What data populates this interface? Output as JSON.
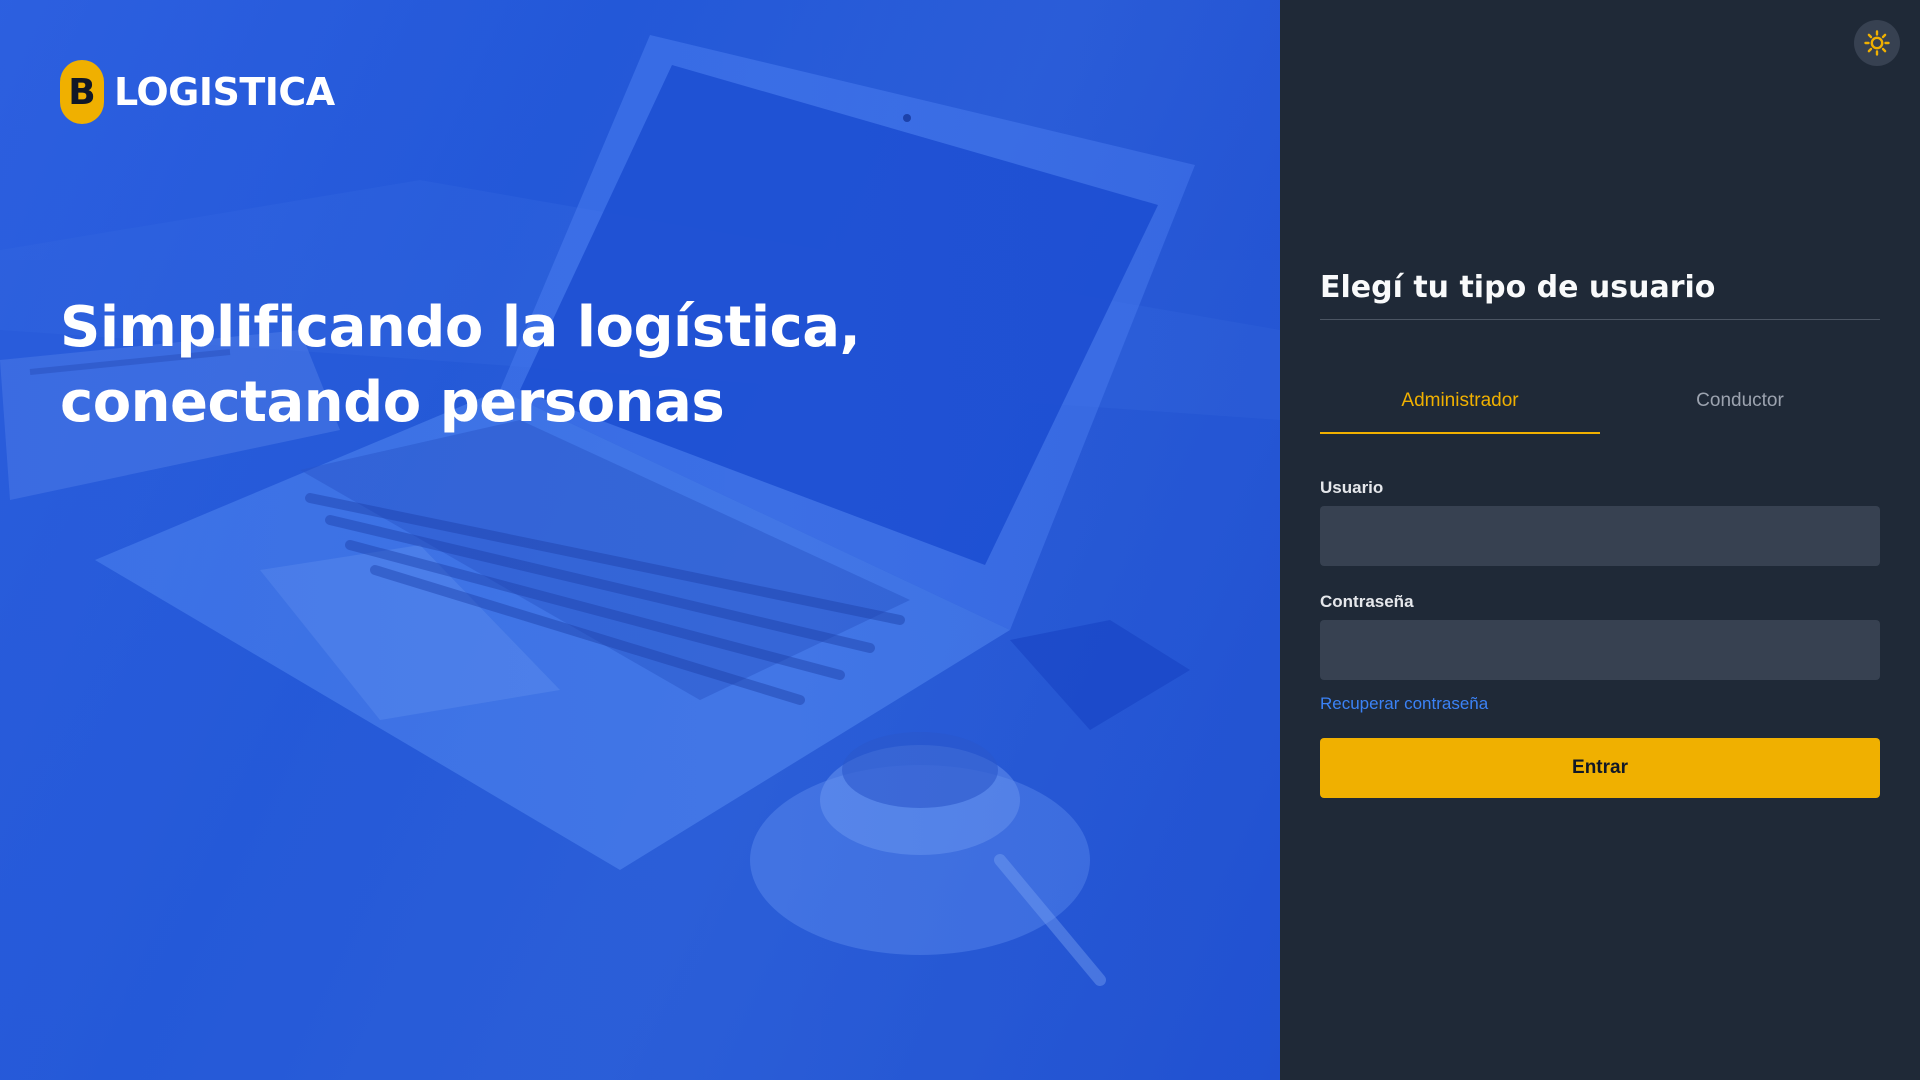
{
  "brand": {
    "badge_letter": "B",
    "name": "LOGISTICA",
    "badge_color": "#f0b000"
  },
  "hero": {
    "headline_line1": "Simplificando la logística,",
    "headline_line2": "conectando personas",
    "background_color": "#2358d8"
  },
  "theme_toggle": {
    "icon": "sun-icon",
    "icon_color": "#f0b000"
  },
  "login": {
    "title": "Elegí tu tipo de usuario",
    "tabs": [
      {
        "label": "Administrador",
        "active": true
      },
      {
        "label": "Conductor",
        "active": false
      }
    ],
    "username_label": "Usuario",
    "username_value": "",
    "password_label": "Contraseña",
    "password_value": "",
    "recover_link": "Recuperar contraseña",
    "submit_label": "Entrar",
    "panel_color": "#1f2937",
    "accent_color": "#f0b000",
    "link_color": "#3b82f6"
  }
}
